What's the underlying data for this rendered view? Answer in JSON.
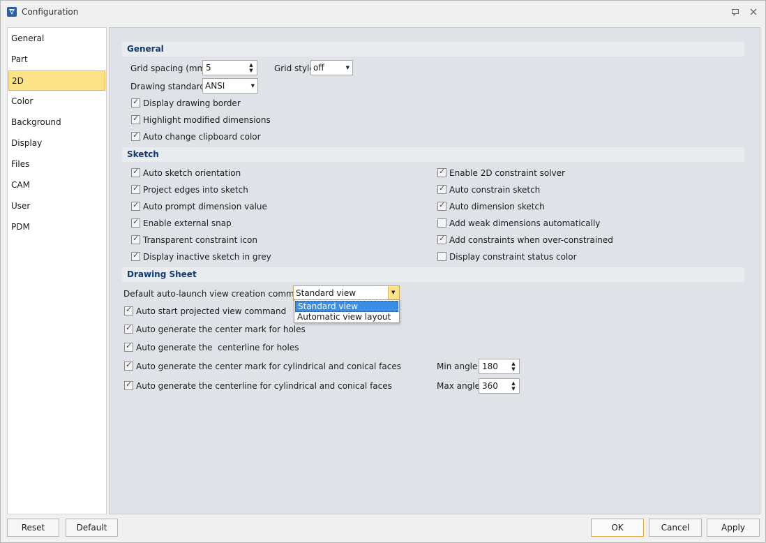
{
  "window": {
    "title": "Configuration"
  },
  "sidebar": {
    "items": [
      "General",
      "Part",
      "2D",
      "Color",
      "Background",
      "Display",
      "Files",
      "CAM",
      "User",
      "PDM"
    ],
    "active": "2D"
  },
  "general": {
    "header": "General",
    "grid_spacing_label": "Grid spacing (mm)",
    "grid_spacing_value": "5",
    "grid_style_label": "Grid style",
    "grid_style_value": "off",
    "drawing_standard_label": "Drawing standard",
    "drawing_standard_value": "ANSI",
    "display_border": "Display drawing border",
    "highlight_modified": "Highlight modified dimensions",
    "auto_clipboard": "Auto change clipboard color"
  },
  "sketch": {
    "header": "Sketch",
    "left": [
      {
        "label": "Auto sketch orientation",
        "checked": true
      },
      {
        "label": "Project edges into sketch",
        "checked": true
      },
      {
        "label": "Auto prompt dimension value",
        "checked": true
      },
      {
        "label": "Enable external snap",
        "checked": true
      },
      {
        "label": "Transparent constraint icon",
        "checked": true
      },
      {
        "label": "Display inactive sketch in grey",
        "checked": true
      }
    ],
    "right": [
      {
        "label": "Enable 2D constraint solver",
        "checked": true
      },
      {
        "label": "Auto constrain sketch",
        "checked": true
      },
      {
        "label": "Auto dimension sketch",
        "checked": true
      },
      {
        "label": "Add weak dimensions automatically",
        "checked": false
      },
      {
        "label": "Add constraints when over-constrained",
        "checked": true
      },
      {
        "label": "Display constraint status color",
        "checked": false
      }
    ]
  },
  "drawing_sheet": {
    "header": "Drawing Sheet",
    "default_view_label": "Default auto-launch view creation command",
    "default_view_value": "Standard view",
    "dropdown_options": [
      "Standard view",
      "Automatic view layout"
    ],
    "auto_projected": "Auto start projected view command",
    "center_mark_holes": "Auto generate the center mark for holes",
    "centerline_holes": "Auto generate the  centerline for holes",
    "center_mark_cyl": "Auto generate the center mark for cylindrical and conical faces",
    "centerline_cyl": "Auto generate the centerline for cylindrical and conical faces",
    "min_angle_label": "Min angle",
    "min_angle_value": "180",
    "max_angle_label": "Max angle",
    "max_angle_value": "360"
  },
  "footer": {
    "reset": "Reset",
    "default": "Default",
    "ok": "OK",
    "cancel": "Cancel",
    "apply": "Apply"
  }
}
